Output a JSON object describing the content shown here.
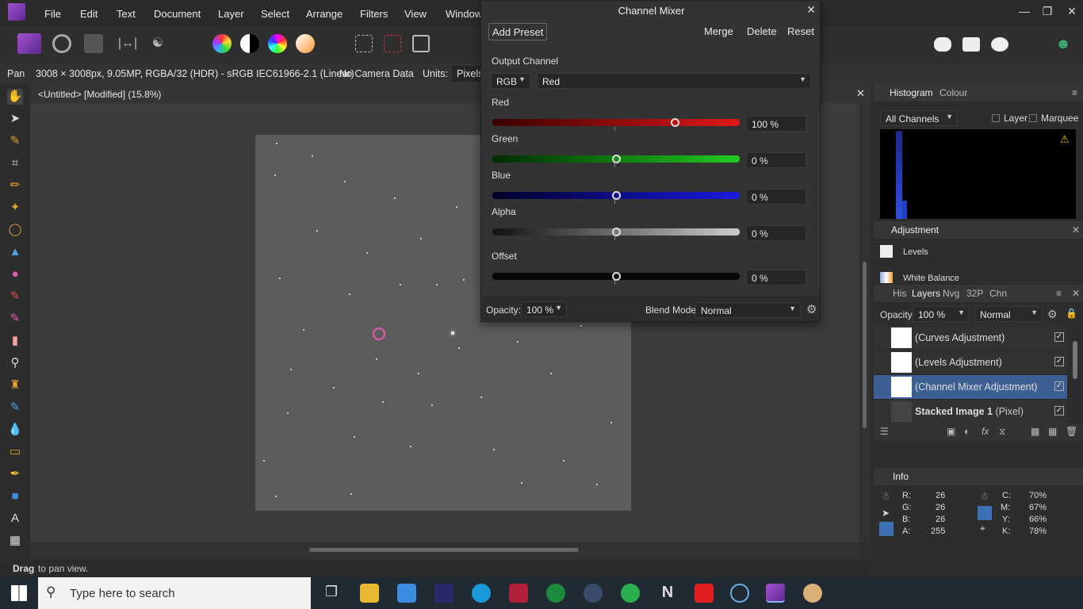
{
  "menubar": {
    "items": [
      "File",
      "Edit",
      "Text",
      "Document",
      "Layer",
      "Select",
      "Arrange",
      "Filters",
      "View",
      "Window"
    ]
  },
  "context_bar": {
    "tool_name": "Pan",
    "doc_info": "3008 × 3008px, 9.05MP, RGBA/32 (HDR) - sRGB IEC61966-2.1 (Linear)",
    "camera": "No Camera Data",
    "units_label": "Units:",
    "units_value": "Pixels"
  },
  "document": {
    "tab_title": "<Untitled> [Modified] (15.8%)"
  },
  "status_bar": {
    "bold": "Drag",
    "text": "to pan view."
  },
  "channel_mixer": {
    "title": "Channel Mixer",
    "add_preset": "Add Preset",
    "merge": "Merge",
    "delete": "Delete",
    "reset": "Reset",
    "output_channel_label": "Output Channel",
    "mode": "RGB",
    "channel": "Red",
    "sliders": [
      {
        "label": "Red",
        "value": "100 %",
        "level": 0.74
      },
      {
        "label": "Green",
        "value": "0 %",
        "level": 0.5
      },
      {
        "label": "Blue",
        "value": "0 %",
        "level": 0.5
      },
      {
        "label": "Alpha",
        "value": "0 %",
        "level": 0.5
      },
      {
        "label": "Offset",
        "value": "0 %",
        "level": 0.5
      }
    ],
    "opacity_label": "Opacity:",
    "opacity_value": "100 %",
    "blend_label": "Blend Mode:",
    "blend_value": "Normal"
  },
  "histogram_panel": {
    "tabs": [
      "Histogram",
      "Colour"
    ],
    "channels": "All Channels",
    "layer_label": "Layer",
    "marquee_label": "Marquee"
  },
  "adjustment_panel": {
    "title": "Adjustment",
    "items": [
      "Levels",
      "White Balance"
    ]
  },
  "layers_panel": {
    "tabs": [
      "His",
      "Layers",
      "Nvg",
      "32P",
      "Chn"
    ],
    "opacity_label": "Opacity:",
    "opacity_value": "100 %",
    "blend_value": "Normal",
    "layers": [
      {
        "name": "(Curves Adjustment)",
        "suffix": ""
      },
      {
        "name": "(Levels Adjustment)",
        "suffix": ""
      },
      {
        "name": "(Channel Mixer Adjustment)",
        "suffix": ""
      },
      {
        "name": "Stacked Image 1",
        "suffix": "(Pixel)"
      }
    ]
  },
  "info_panel": {
    "title": "Info",
    "rgb": [
      {
        "label": "R:",
        "value": "26"
      },
      {
        "label": "G:",
        "value": "26"
      },
      {
        "label": "B:",
        "value": "26"
      },
      {
        "label": "A:",
        "value": "255"
      }
    ],
    "cmyk": [
      {
        "label": "C:",
        "value": "70%"
      },
      {
        "label": "M:",
        "value": "67%"
      },
      {
        "label": "Y:",
        "value": "66%"
      },
      {
        "label": "K:",
        "value": "78%"
      }
    ]
  },
  "taskbar": {
    "search_placeholder": "Type here to search"
  },
  "colors": {
    "accent": "#3d5f93",
    "red_track": "#e01818",
    "green_track": "#22cc22",
    "blue_track": "#1a1ae0"
  }
}
